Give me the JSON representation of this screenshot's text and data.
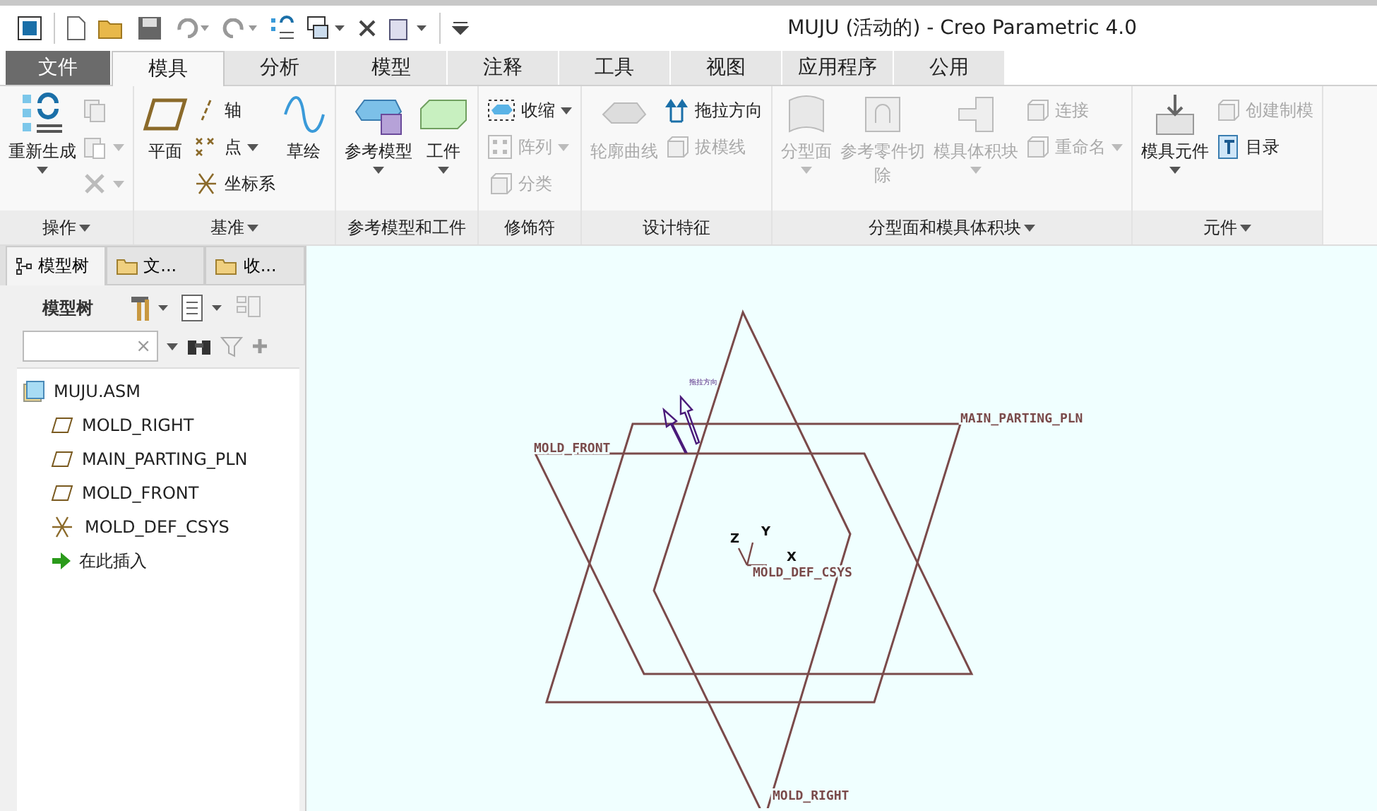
{
  "window": {
    "title": "MUJU (活动的) - Creo Parametric 4.0"
  },
  "ribbon_tabs": [
    {
      "label": "文件",
      "kind": "file",
      "selected": false
    },
    {
      "label": "模具",
      "kind": "tab",
      "selected": true
    },
    {
      "label": "分析",
      "kind": "tab",
      "selected": false
    },
    {
      "label": "模型",
      "kind": "tab",
      "selected": false
    },
    {
      "label": "注释",
      "kind": "tab",
      "selected": false
    },
    {
      "label": "工具",
      "kind": "tab",
      "selected": false
    },
    {
      "label": "视图",
      "kind": "tab",
      "selected": false
    },
    {
      "label": "应用程序",
      "kind": "tab",
      "selected": false
    },
    {
      "label": "公用",
      "kind": "tab",
      "selected": false
    }
  ],
  "ribbon_groups": [
    {
      "label": "操作",
      "menu": true,
      "columns": [
        {
          "kind": "large",
          "items": [
            {
              "label": "重新生成",
              "dropdown": true,
              "disabled": false
            }
          ]
        },
        {
          "kind": "stack",
          "items": [
            {
              "dropdown": false,
              "disabled": true
            },
            {
              "dropdown": true,
              "disabled": true
            },
            {
              "dropdown": true,
              "disabled": true
            }
          ]
        }
      ]
    },
    {
      "label": "基准",
      "menu": true,
      "columns": [
        {
          "kind": "large",
          "items": [
            {
              "label": "平面",
              "dropdown": false,
              "disabled": false
            }
          ]
        },
        {
          "kind": "stack",
          "items": [
            {
              "label": "轴",
              "dropdown": false,
              "disabled": false
            },
            {
              "label": "点",
              "dropdown": true,
              "disabled": false
            },
            {
              "label": "坐标系",
              "dropdown": false,
              "disabled": false
            }
          ]
        },
        {
          "kind": "large",
          "items": [
            {
              "label": "草绘",
              "dropdown": false,
              "disabled": false
            }
          ]
        }
      ]
    },
    {
      "label": "参考模型和工件",
      "menu": false,
      "columns": [
        {
          "kind": "large",
          "items": [
            {
              "label": "参考模型",
              "dropdown": true,
              "disabled": false
            }
          ]
        },
        {
          "kind": "large",
          "items": [
            {
              "label": "工件",
              "dropdown": true,
              "disabled": false
            }
          ]
        }
      ]
    },
    {
      "label": "修饰符",
      "menu": false,
      "columns": [
        {
          "kind": "stack",
          "items": [
            {
              "label": "收缩",
              "dropdown": true,
              "disabled": false
            },
            {
              "label": "阵列",
              "dropdown": true,
              "disabled": true
            },
            {
              "label": "分类",
              "dropdown": false,
              "disabled": true
            }
          ]
        }
      ]
    },
    {
      "label": "设计特征",
      "menu": false,
      "columns": [
        {
          "kind": "large",
          "items": [
            {
              "label": "轮廓曲线",
              "dropdown": false,
              "disabled": true
            }
          ]
        },
        {
          "kind": "stack",
          "items": [
            {
              "label": "拖拉方向",
              "dropdown": false,
              "disabled": false
            },
            {
              "label": "拔模线",
              "dropdown": false,
              "disabled": true
            }
          ]
        }
      ]
    },
    {
      "label": "分型面和模具体积块",
      "menu": true,
      "columns": [
        {
          "kind": "large",
          "items": [
            {
              "label": "分型面",
              "dropdown": true,
              "disabled": true
            }
          ]
        },
        {
          "kind": "large",
          "items": [
            {
              "label": "参考零件切除",
              "dropdown": false,
              "disabled": true
            }
          ]
        },
        {
          "kind": "large",
          "items": [
            {
              "label": "模具体积块",
              "dropdown": true,
              "disabled": true
            }
          ]
        },
        {
          "kind": "stack",
          "items": [
            {
              "label": "连接",
              "dropdown": false,
              "disabled": true
            },
            {
              "label": "重命名",
              "dropdown": true,
              "disabled": true
            }
          ]
        }
      ]
    },
    {
      "label": "元件",
      "menu": true,
      "columns": [
        {
          "kind": "large",
          "items": [
            {
              "label": "模具元件",
              "dropdown": true,
              "disabled": false
            }
          ]
        },
        {
          "kind": "stack",
          "items": [
            {
              "label": "创建制模",
              "dropdown": false,
              "disabled": true
            },
            {
              "label": "目录",
              "dropdown": false,
              "disabled": false
            }
          ]
        }
      ]
    }
  ],
  "panel_tabs": [
    {
      "label": "模型树",
      "selected": true
    },
    {
      "label": "文...",
      "selected": false
    },
    {
      "label": "收...",
      "selected": false
    }
  ],
  "model_tree": {
    "title": "模型树",
    "search": {
      "clear": "×"
    },
    "items": [
      {
        "label": "MUJU.ASM",
        "kind": "assembly",
        "children": [
          {
            "label": "MOLD_RIGHT",
            "kind": "plane"
          },
          {
            "label": "MAIN_PARTING_PLN",
            "kind": "plane"
          },
          {
            "label": "MOLD_FRONT",
            "kind": "plane"
          },
          {
            "label": "MOLD_DEF_CSYS",
            "kind": "csys"
          },
          {
            "label": "在此插入",
            "kind": "insert"
          }
        ]
      }
    ]
  },
  "viewport": {
    "datum_planes": [
      {
        "label": "MAIN_PARTING_PLN"
      },
      {
        "label": "MOLD_FRONT"
      },
      {
        "label": "MOLD_RIGHT"
      }
    ],
    "pull_direction": {
      "label": "拖拉方向"
    },
    "csys": {
      "label": "MOLD_DEF_CSYS",
      "axes": [
        "Z",
        "Y",
        "X"
      ]
    }
  }
}
